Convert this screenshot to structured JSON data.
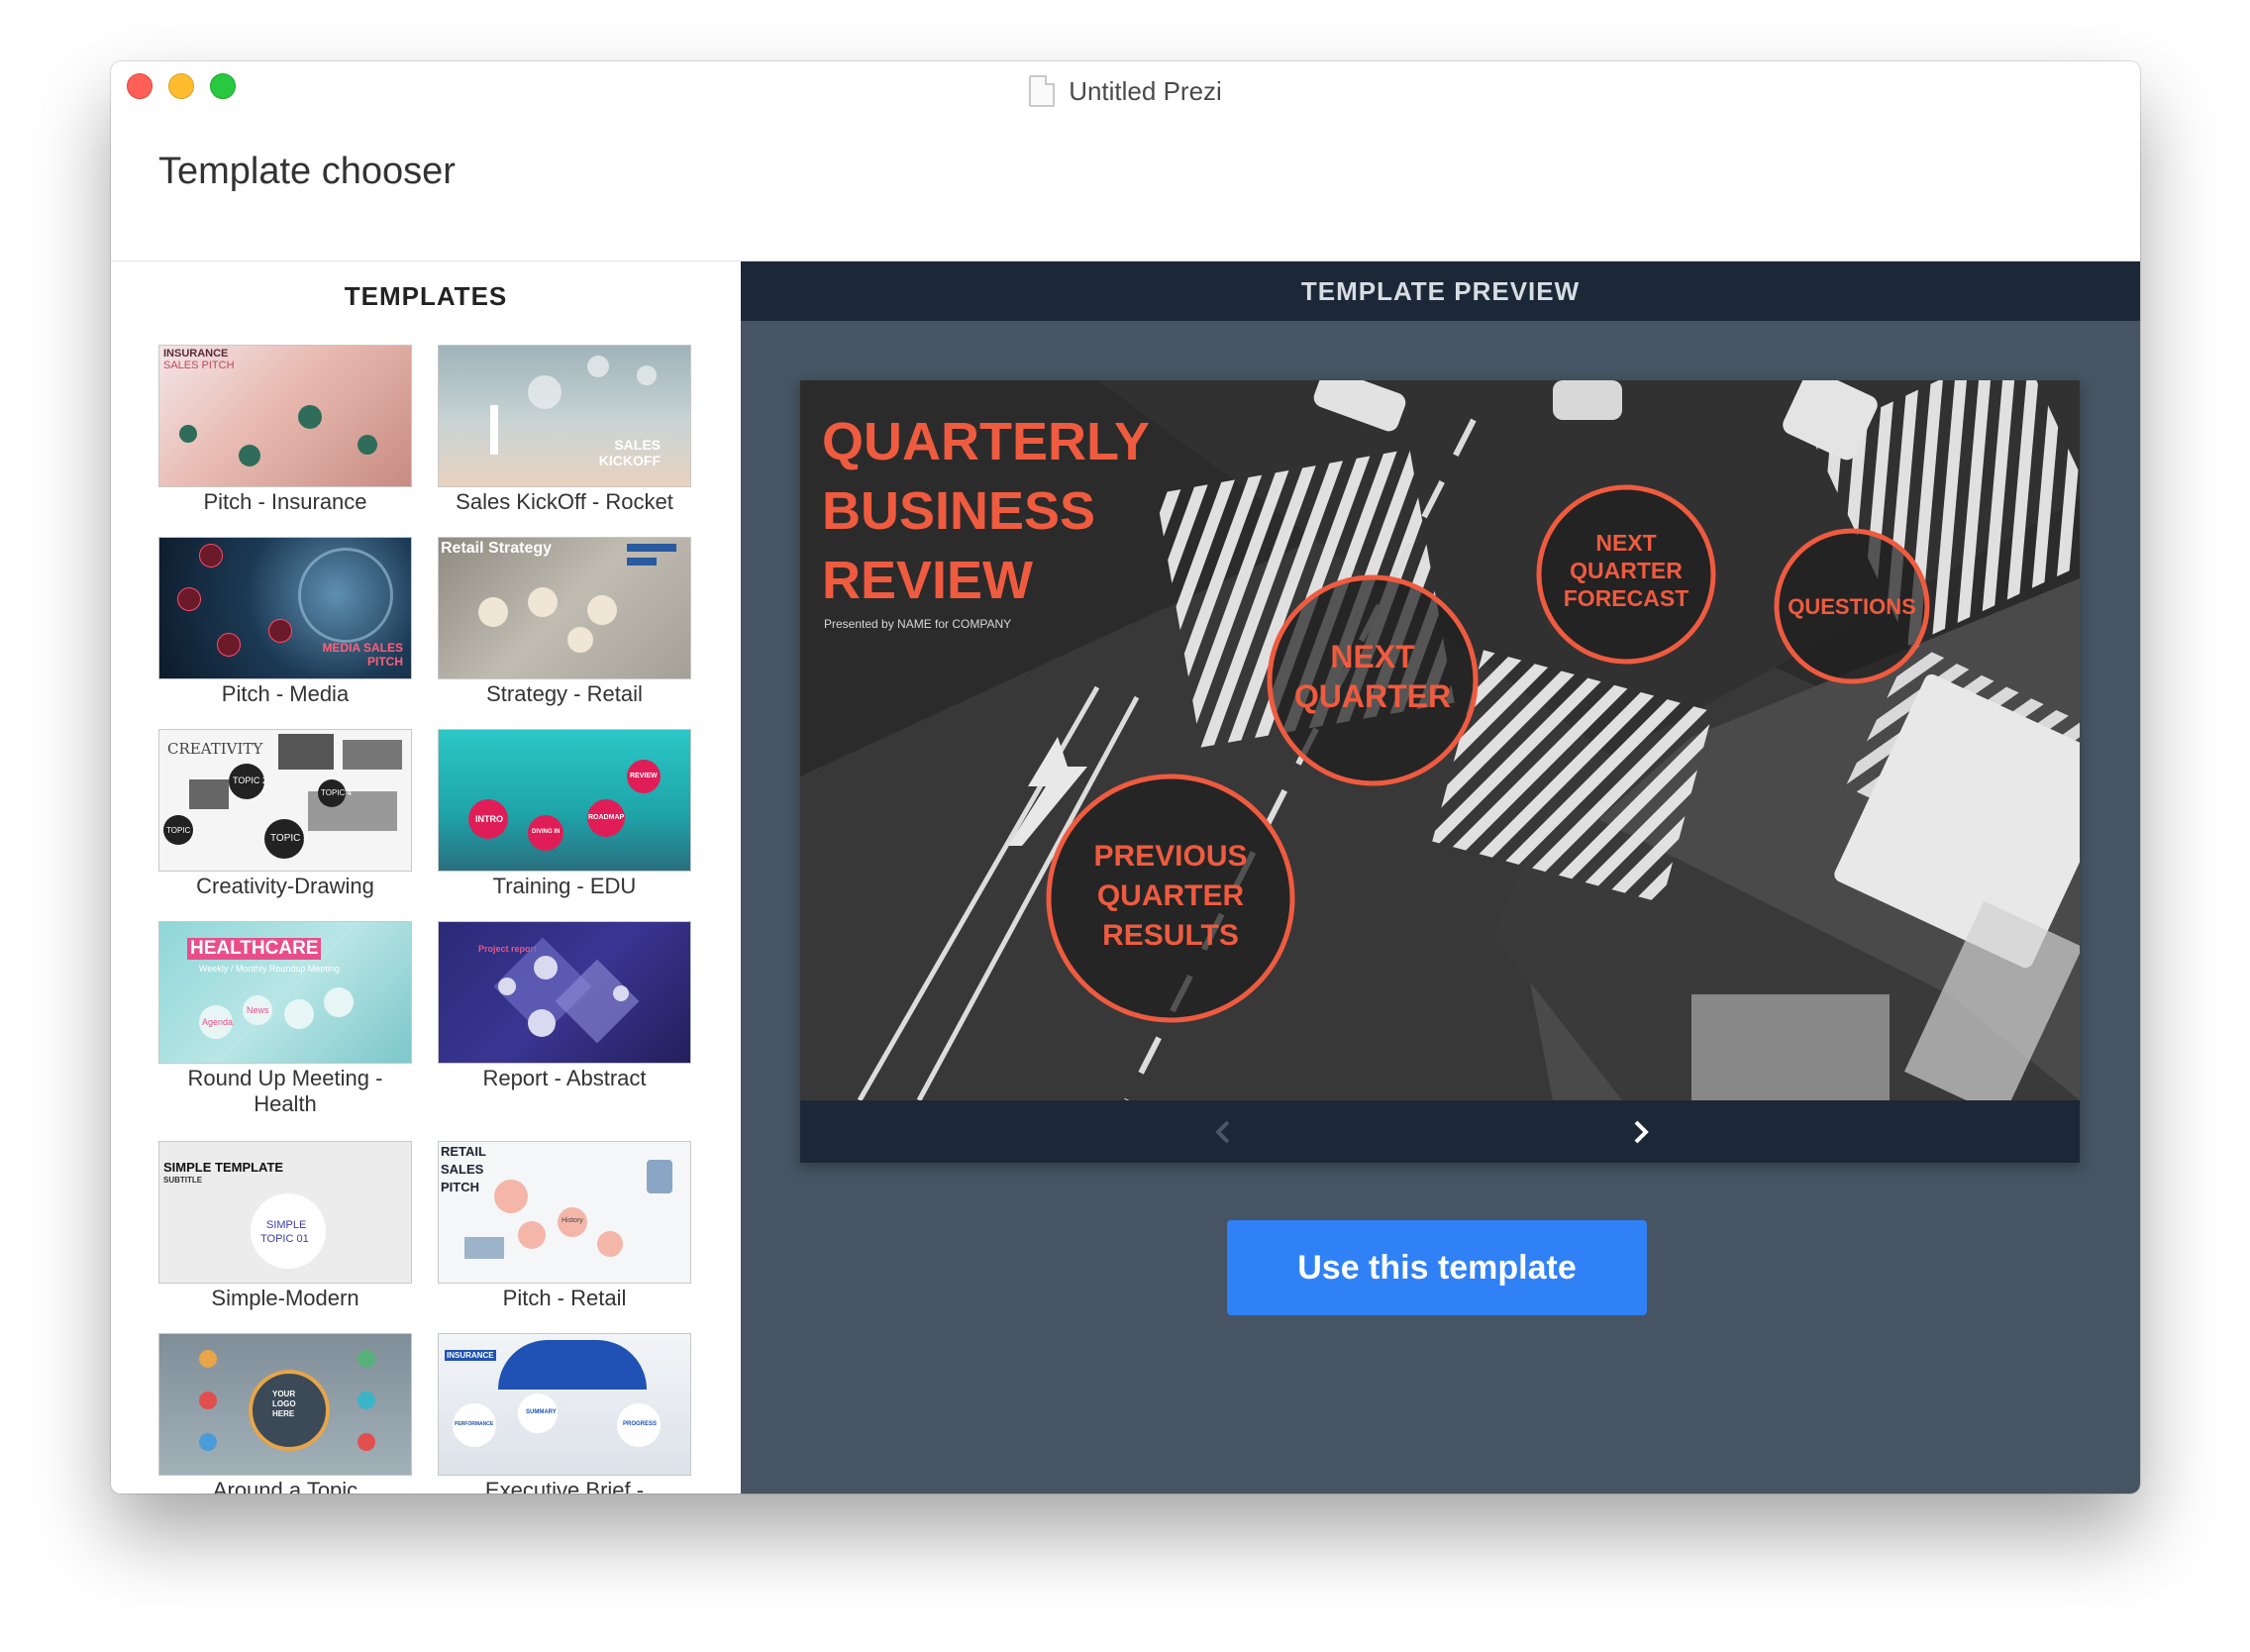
{
  "window": {
    "title": "Untitled Prezi"
  },
  "header": {
    "title": "Template chooser"
  },
  "templates_panel": {
    "heading": "TEMPLATES",
    "items": [
      {
        "label": "Pitch - Insurance",
        "thumb_text": [
          "INSURANCE",
          "SALES PITCH"
        ]
      },
      {
        "label": "Sales KickOff - Rocket",
        "thumb_text": [
          "SALES",
          "KICKOFF"
        ]
      },
      {
        "label": "Pitch - Media",
        "thumb_text": [
          "MEDIA SALES",
          "PITCH"
        ]
      },
      {
        "label": "Strategy - Retail",
        "thumb_text": [
          "Retail Strategy"
        ]
      },
      {
        "label": "Creativity-Drawing",
        "thumb_text": [
          "CREATIVITY",
          "TOPIC 2",
          "TOPIC 4",
          "TOPIC 1",
          "TOPIC 3"
        ]
      },
      {
        "label": "Training - EDU",
        "thumb_text": [
          "INTRO",
          "REVIEW",
          "ROADMAP",
          "DIVING IN"
        ]
      },
      {
        "label": "Round Up Meeting - Health",
        "thumb_text": [
          "HEALTHCARE",
          "Weekly / Monthly Roundup Meeting",
          "Agenda",
          "News"
        ]
      },
      {
        "label": "Report - Abstract",
        "thumb_text": [
          "Project report"
        ]
      },
      {
        "label": "Simple-Modern",
        "thumb_text": [
          "SIMPLE TEMPLATE",
          "SUBTITLE",
          "SIMPLE",
          "TOPIC 01"
        ]
      },
      {
        "label": "Pitch - Retail",
        "thumb_text": [
          "RETAIL",
          "SALES",
          "PITCH",
          "History"
        ]
      },
      {
        "label": "Around a Topic",
        "thumb_text": [
          "YOUR",
          "LOGO",
          "HERE"
        ]
      },
      {
        "label": "Executive Brief - Insurance",
        "thumb_text": [
          "INSURANCE",
          "SUMMARY",
          "PERFORMANCE",
          "PROGRESS"
        ]
      }
    ]
  },
  "preview_panel": {
    "heading": "TEMPLATE PREVIEW",
    "slide": {
      "title_lines": [
        "QUARTERLY",
        "BUSINESS",
        "REVIEW"
      ],
      "subtitle": "Presented by NAME for COMPANY",
      "circles": {
        "next_quarter": [
          "NEXT",
          "QUARTER"
        ],
        "forecast": [
          "NEXT",
          "QUARTER",
          "FORECAST"
        ],
        "questions": [
          "QUESTIONS"
        ],
        "previous": [
          "PREVIOUS",
          "QUARTER",
          "RESULTS"
        ]
      }
    },
    "prev_icon": "chevron-left-icon",
    "next_icon": "chevron-right-icon",
    "use_button": "Use this template"
  },
  "colors": {
    "accent": "#3081f5",
    "slide_accent": "#e8533a",
    "panel_bg": "#465463",
    "bar_bg": "#1c2838"
  }
}
